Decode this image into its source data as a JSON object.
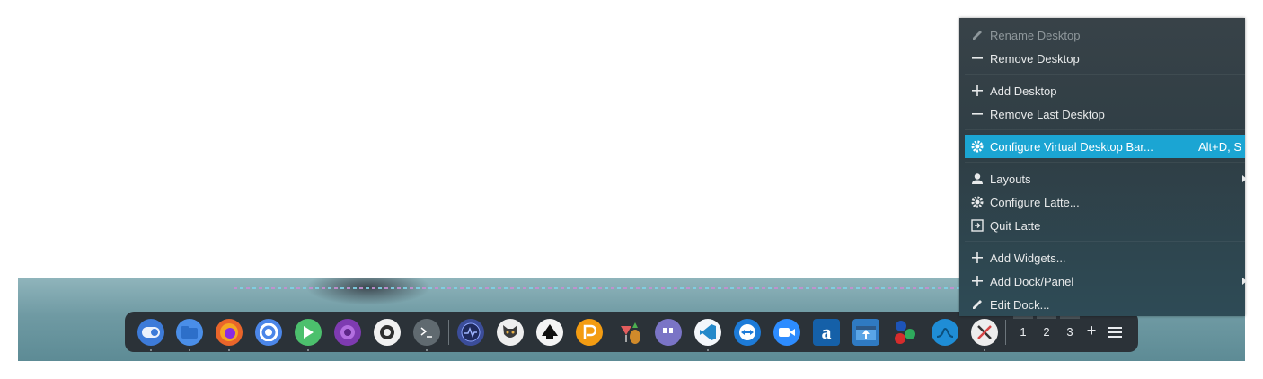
{
  "context_menu": {
    "items": [
      {
        "label": "Rename Desktop",
        "icon": "pencil-icon",
        "disabled": true
      },
      {
        "label": "Remove Desktop",
        "icon": "minus-icon"
      },
      {
        "label": "Add Desktop",
        "icon": "plus-icon"
      },
      {
        "label": "Remove Last Desktop",
        "icon": "minus-icon"
      },
      {
        "label": "Configure Virtual Desktop Bar...",
        "icon": "gear-icon",
        "shortcut": "Alt+D, S",
        "highlighted": true
      },
      {
        "label": "Layouts",
        "icon": "user-icon",
        "submenu": true
      },
      {
        "label": "Configure Latte...",
        "icon": "gear-icon"
      },
      {
        "label": "Quit Latte",
        "icon": "exit-icon"
      },
      {
        "label": "Add Widgets...",
        "icon": "plus-icon"
      },
      {
        "label": "Add Dock/Panel",
        "icon": "plus-icon",
        "submenu": true
      },
      {
        "label": "Edit Dock...",
        "icon": "pencil-icon"
      }
    ]
  },
  "dock": {
    "apps": [
      {
        "name": "toggle-app-icon",
        "color": "#3d7bd9"
      },
      {
        "name": "files-icon",
        "color": "#4a8ee8"
      },
      {
        "name": "firefox-icon",
        "color": "#e9652a"
      },
      {
        "name": "chromium-icon",
        "color": "#4b86e8"
      },
      {
        "name": "media-player-icon",
        "color": "#4cc06d"
      },
      {
        "name": "tor-browser-icon",
        "color": "#7e3bb1"
      },
      {
        "name": "obs-icon",
        "color": "#f1f1f1"
      },
      {
        "name": "terminal-icon",
        "color": "#606a70"
      },
      {
        "name": "system-monitor-icon",
        "color": "#3b4d9a"
      },
      {
        "name": "gimp-icon",
        "color": "#eeeeee"
      },
      {
        "name": "inkscape-icon",
        "color": "#f4f4f4"
      },
      {
        "name": "plex-icon",
        "color": "#f39c12"
      },
      {
        "name": "playonlinux-icon",
        "color": "#d6852a"
      },
      {
        "name": "quotes-app-icon",
        "color": "#7a74c6"
      },
      {
        "name": "vscode-icon",
        "color": "#f4f7fb"
      },
      {
        "name": "teamviewer-icon",
        "color": "#1d7bd8"
      },
      {
        "name": "zoom-icon",
        "color": "#2d8cff"
      },
      {
        "name": "anydesk-icon",
        "color": "#1560a8"
      },
      {
        "name": "installer-icon",
        "color": "#2f7ac2"
      },
      {
        "name": "molecule-icon",
        "color": "#1d54b8"
      },
      {
        "name": "wave-app-icon",
        "color": "#1f8dd6"
      },
      {
        "name": "x-app-icon",
        "color": "#ededed"
      }
    ],
    "desktops": [
      "1",
      "2",
      "3"
    ],
    "add_symbol": "+"
  }
}
